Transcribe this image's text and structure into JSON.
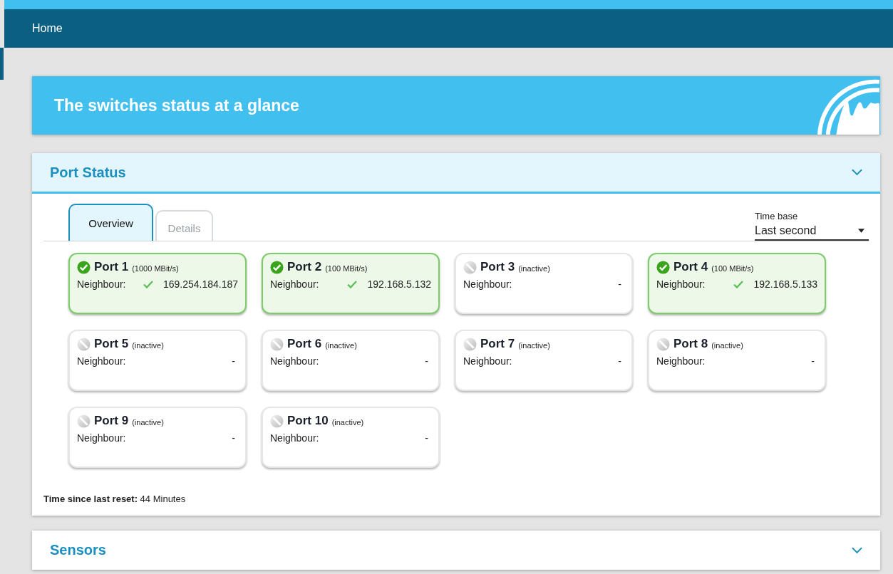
{
  "nav": {
    "home": "Home"
  },
  "banner": {
    "title": "The switches status at a glance"
  },
  "port_status": {
    "title": "Port Status",
    "expanded": true,
    "tabs": [
      {
        "label": "Overview",
        "selected": true
      },
      {
        "label": "Details",
        "selected": false
      }
    ],
    "time_base": {
      "label": "Time base",
      "value": "Last second"
    },
    "ports": [
      {
        "name": "Port 1",
        "speed": "(1000 MBit/s)",
        "active": true,
        "neighbour_label": "Neighbour:",
        "neighbour": "169.254.184.187"
      },
      {
        "name": "Port 2",
        "speed": "(100 MBit/s)",
        "active": true,
        "neighbour_label": "Neighbour:",
        "neighbour": "192.168.5.132"
      },
      {
        "name": "Port 3",
        "speed": "(inactive)",
        "active": false,
        "neighbour_label": "Neighbour:",
        "neighbour": "-"
      },
      {
        "name": "Port 4",
        "speed": "(100 MBit/s)",
        "active": true,
        "neighbour_label": "Neighbour:",
        "neighbour": "192.168.5.133"
      },
      {
        "name": "Port 5",
        "speed": "(inactive)",
        "active": false,
        "neighbour_label": "Neighbour:",
        "neighbour": "-"
      },
      {
        "name": "Port 6",
        "speed": "(inactive)",
        "active": false,
        "neighbour_label": "Neighbour:",
        "neighbour": "-"
      },
      {
        "name": "Port 7",
        "speed": "(inactive)",
        "active": false,
        "neighbour_label": "Neighbour:",
        "neighbour": "-"
      },
      {
        "name": "Port 8",
        "speed": "(inactive)",
        "active": false,
        "neighbour_label": "Neighbour:",
        "neighbour": "-"
      },
      {
        "name": "Port 9",
        "speed": "(inactive)",
        "active": false,
        "neighbour_label": "Neighbour:",
        "neighbour": "-"
      },
      {
        "name": "Port 10",
        "speed": "(inactive)",
        "active": false,
        "neighbour_label": "Neighbour:",
        "neighbour": "-"
      }
    ],
    "reset": "**Time since last reset:** 44 Minutes"
  },
  "sensors": {
    "title": "Sensors",
    "expanded": false
  }
}
